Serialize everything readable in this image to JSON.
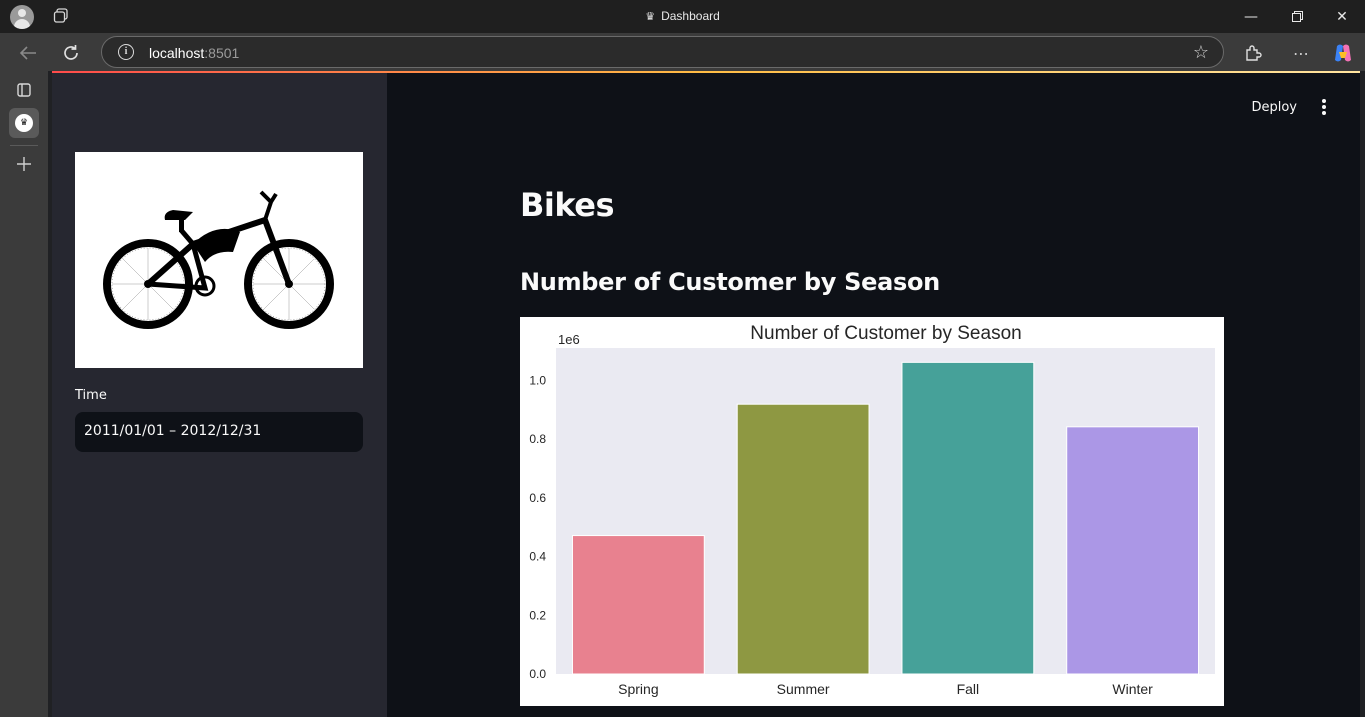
{
  "browser": {
    "window_title": "Dashboard",
    "url_host": "localhost",
    "url_port": ":8501"
  },
  "app": {
    "deploy_label": "Deploy",
    "sidebar": {
      "time_label": "Time",
      "date_range_value": "2011/01/01 – 2012/12/31"
    },
    "title": "Bikes",
    "subheader": "Number of Customer by Season"
  },
  "icons": {
    "profile": "profile-icon",
    "workspaces": "workspaces-icon",
    "back": "back-arrow-icon",
    "reload": "reload-icon",
    "info": "site-info-icon",
    "favorite": "star-icon",
    "extensions": "extensions-icon",
    "more": "more-horizontal-icon",
    "copilot": "copilot-icon",
    "tab_actions": "tab-actions-icon",
    "new_tab": "plus-icon",
    "deploy_menu": "more-vertical-icon"
  },
  "colors": {
    "app_bg": "#0e1117",
    "sidebar_bg": "#262730",
    "accent_gradient_start": "#ff4b4b"
  },
  "chart_data": {
    "type": "bar",
    "title": "Number of Customer by Season",
    "scale_label": "1e6",
    "categories": [
      "Spring",
      "Summer",
      "Fall",
      "Winter"
    ],
    "values": [
      471348,
      918589,
      1061129,
      841613
    ],
    "colors": [
      "#e8818f",
      "#8e9842",
      "#46a199",
      "#ab97e6"
    ],
    "ylim": [
      0,
      1110000
    ],
    "yticks": [
      0.0,
      0.2,
      0.4,
      0.6,
      0.8,
      1.0
    ],
    "ytick_labels": [
      "0.0",
      "0.2",
      "0.4",
      "0.6",
      "0.8",
      "1.0"
    ],
    "xlabel": "",
    "ylabel": "",
    "grid": false,
    "plot_bg": "#eaeaf2"
  }
}
